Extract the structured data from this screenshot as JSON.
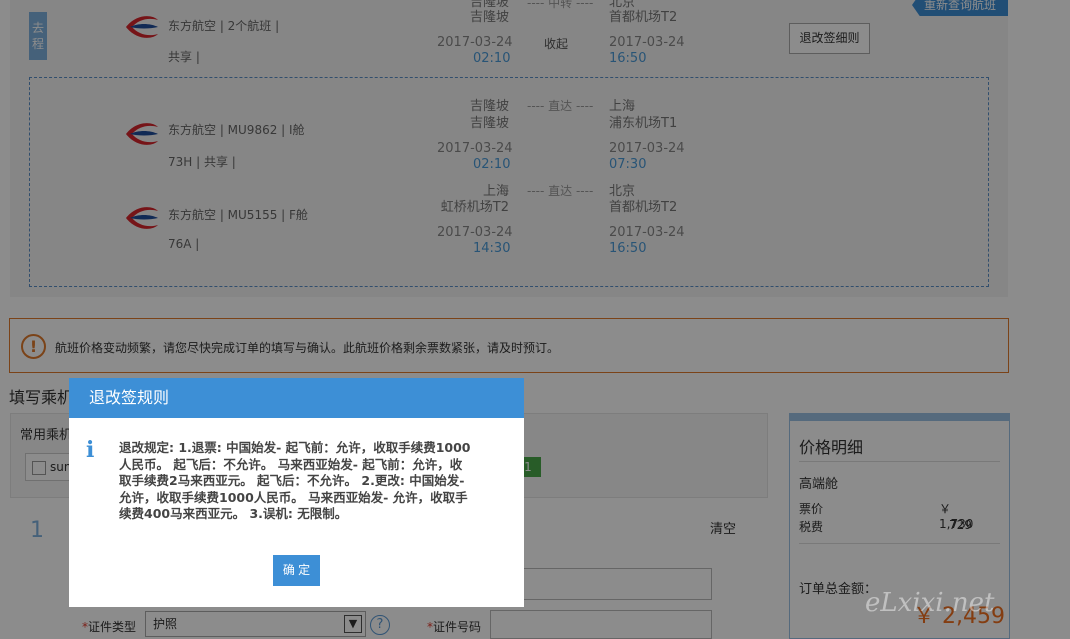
{
  "header": {
    "requery_label": "重新查询航班"
  },
  "flight": {
    "go_tag": "去程",
    "main": {
      "airline": "东方航空 | 2个航班 |",
      "sub": "共享 |",
      "dep_airport_1": "吉隆坡",
      "dep_airport_2": "吉隆坡",
      "mid": "---- 中转 ----",
      "arr_city": "北京",
      "arr_airport": "首都机场T2",
      "dep_date": "2017-03-24",
      "dep_time": "02:10",
      "mid2": "收起",
      "arr_date": "2017-03-24",
      "arr_time": "16:50"
    },
    "rule_button": "退改签细则",
    "legs": [
      {
        "airline": "东方航空 | MU9862 | I舱",
        "sub": "73H | 共享 |",
        "dep_city": "吉隆坡",
        "dep_airport": "吉隆坡",
        "mid": "---- 直达 ----",
        "arr_city": "上海",
        "arr_airport": "浦东机场T1",
        "dep_date": "2017-03-24",
        "dep_time": "02:10",
        "arr_date": "2017-03-24",
        "arr_time": "07:30"
      },
      {
        "airline": "东方航空 | MU5155 | F舱",
        "sub": "76A |",
        "dep_city": "上海",
        "dep_airport": "虹桥机场T2",
        "mid": "---- 直达 ----",
        "arr_city": "北京",
        "arr_airport": "首都机场T2",
        "dep_date": "2017-03-24",
        "dep_time": "14:30",
        "arr_date": "2017-03-24",
        "arr_time": "16:50"
      }
    ]
  },
  "warning": {
    "icon": "!",
    "text": "航班价格变动频繁，请您尽快完成订单的填写与确认。此航班价格剩余票数紧张，请及时预订。"
  },
  "passenger": {
    "section_title": "填写乘机",
    "common_label": "常用乘机",
    "checkbox_label": "sun",
    "badge": "1",
    "number": "1",
    "clear": "清空",
    "doc_type_label": "证件类型",
    "doc_type_value": "护照",
    "doc_number_label": "证件号码",
    "required_mark": "*",
    "help_icon": "?"
  },
  "price": {
    "title": "价格明细",
    "cabin": "高端舱",
    "rows": [
      {
        "label": "票价",
        "value": "￥ 1,730"
      },
      {
        "label": "税费",
        "value": "729"
      }
    ],
    "total_label": "订单总金额：",
    "total_value": "￥ 2,459"
  },
  "modal": {
    "title": "退改签规则",
    "info_icon": "i",
    "body": "退改规定: 1.退票: 中国始发- 起飞前：允许，收取手续费1000人民币。 起飞后：不允许。 马来西亚始发- 起飞前：允许，收取手续费2马来西亚元。 起飞后：不允许。 2.更改: 中国始发- 允许，收取手续费1000人民币。 马来西亚始发- 允许，收取手续费400马来西亚元。 3.误机: 无限制。",
    "ok_label": "确 定"
  },
  "watermark": "eLxixi.net",
  "colors": {
    "accent": "#3d8fd6",
    "warning": "#e07a2c",
    "price": "#f07020",
    "airline_red": "#d8262c",
    "airline_blue": "#1f4e9c"
  },
  "icons": {
    "airline_logo": "china-eastern-logo-icon",
    "warning": "warning-circle-icon",
    "info": "info-icon",
    "help": "help-circle-icon",
    "select_arrow": "chevron-down-icon"
  }
}
